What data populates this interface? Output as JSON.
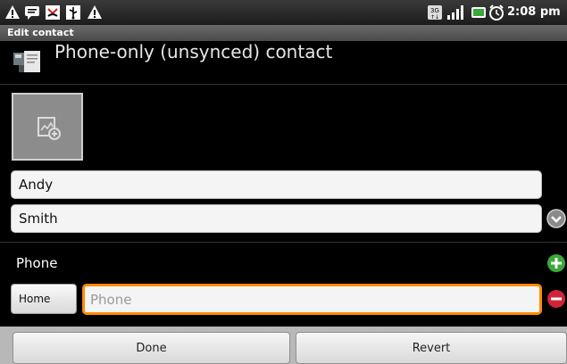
{
  "status_bar": {
    "icons": [
      "warning-icon",
      "message-icon",
      "missed-call-icon",
      "usb-icon",
      "warning-icon",
      "3g-icon",
      "signal-icon",
      "battery-icon",
      "alarm-icon"
    ],
    "time": "2:08 pm"
  },
  "title_bar": {
    "title": "Edit contact"
  },
  "account": {
    "label": "Phone-only (unsynced) contact"
  },
  "name": {
    "first_value": "Andy",
    "last_value": "Smith"
  },
  "phone_section": {
    "label": "Phone",
    "type_label": "Home",
    "placeholder": "Phone",
    "value": ""
  },
  "actions": {
    "done_label": "Done",
    "revert_label": "Revert"
  },
  "colors": {
    "focus": "#ff8a00",
    "add": "#3aa83a",
    "remove": "#d0243a",
    "expand": "#8a8a8a"
  }
}
